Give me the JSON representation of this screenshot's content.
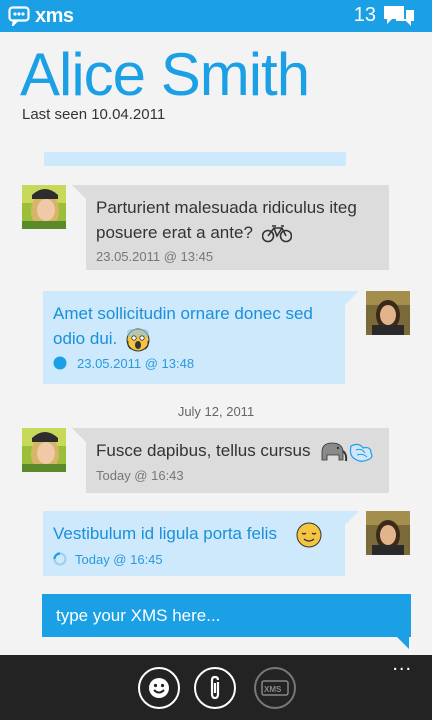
{
  "status_bar": {
    "app_name": "xms",
    "unread_count": "13"
  },
  "contact": {
    "name": "Alice Smith",
    "last_seen": "Last seen 10.04.2011"
  },
  "messages": [
    {
      "direction": "incoming",
      "text": "Parturient malesuada ridiculus iteg posuere erat a ante?",
      "emoji": "bicycle-icon",
      "meta": "23.05.2011 @ 13:45"
    },
    {
      "direction": "outgoing",
      "text": "Amet sollicitudin ornare donec sed odio dui.",
      "emoji": "scream-face-icon",
      "meta": "23.05.2011 @ 13:48",
      "status": "sent-dot"
    },
    {
      "direction": "incoming",
      "text": "Fusce dapibus, tellus cursus",
      "emoji": "elephant-dash-icon",
      "meta": "Today @ 16:43"
    },
    {
      "direction": "outgoing",
      "text": "Vestibulum id ligula porta felis",
      "emoji": "relieved-face-icon",
      "meta": "Today @ 16:45",
      "status": "sending-spinner"
    }
  ],
  "date_separator": "July 12, 2011",
  "composer": {
    "placeholder": "type your XMS here..."
  },
  "app_bar": {
    "more": "...",
    "buttons": [
      {
        "icon": "smiley-icon",
        "enabled": true
      },
      {
        "icon": "paperclip-icon",
        "enabled": true
      },
      {
        "icon": "send-xms-icon",
        "label": "XMS",
        "enabled": false
      }
    ]
  },
  "colors": {
    "accent": "#1b9fe5",
    "incoming_bubble": "#dcdcdc",
    "outgoing_bubble": "#cde9fb",
    "outgoing_text": "#1a8fdb",
    "app_bar": "#232323",
    "background": "#f3f3f3"
  }
}
